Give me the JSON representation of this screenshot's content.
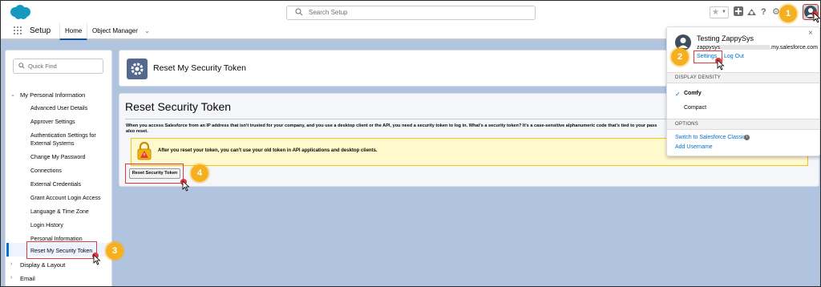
{
  "header": {
    "search_placeholder": "Search Setup"
  },
  "nav": {
    "app_title": "Setup",
    "tabs": [
      {
        "label": "Home"
      },
      {
        "label": "Object Manager"
      }
    ]
  },
  "sidebar": {
    "quick_find_placeholder": "Quick Find",
    "section_my_info": "My Personal Information",
    "items": [
      "Advanced User Details",
      "Approver Settings",
      "Authentication Settings for",
      "External Systems",
      "Change My Password",
      "Connections",
      "External Credentials",
      "Grant Account Login Access",
      "Language & Time Zone",
      "Login History",
      "Personal Information",
      "Reset My Security Token"
    ],
    "section_display": "Display & Layout",
    "section_email": "Email"
  },
  "main": {
    "page_header_title": "Reset My Security Token",
    "card_title": "Reset Security Token",
    "description_line1": "When you access Salesforce from an IP address that isn't trusted for your company, and you use a desktop client or the API, you need a security token to log in. What's a security token? It's a case-sensitive alphanumeric code that's tied to your pass",
    "description_line2": "also reset.",
    "warning_text": "After you reset your token, you can't use your old token in API applications and desktop clients.",
    "reset_button": "Reset Security Token"
  },
  "profile_menu": {
    "name": "Testing ZappySys",
    "username_prefix": "zappysys",
    "username_suffix": ".my.salesforce.com",
    "settings_link": "Settings",
    "logout_link": "Log Out",
    "density_header": "DISPLAY DENSITY",
    "density_options": [
      "Comfy",
      "Compact"
    ],
    "options_header": "OPTIONS",
    "switch_classic": "Switch to Salesforce Classic",
    "add_username": "Add Username"
  },
  "callouts": [
    "1",
    "2",
    "3",
    "4"
  ],
  "colors": {
    "brand_blue": "#1798c1",
    "link_blue": "#0070d2",
    "callout": "#f5b01f",
    "highlight_red": "#e03a3e",
    "warning_bg": "#fffacd"
  }
}
